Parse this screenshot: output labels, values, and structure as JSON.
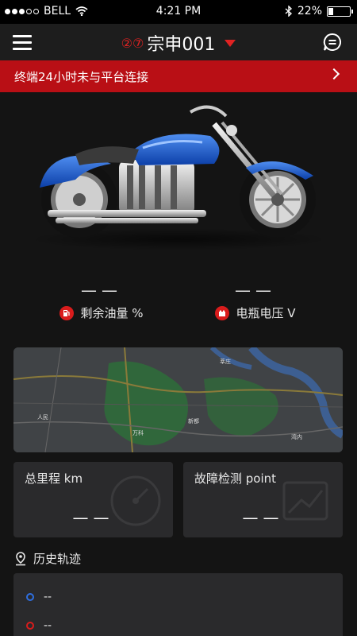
{
  "status_bar": {
    "carrier": "BELL",
    "time": "4:21 PM",
    "battery": "22%",
    "battery_level": 0.22
  },
  "nav": {
    "badge": "②⑦",
    "title": "宗申001"
  },
  "alert": {
    "text": "终端24小时未与平台连接"
  },
  "stats": [
    {
      "value": "——",
      "label": "剩余油量 %",
      "icon": "fuel-icon"
    },
    {
      "value": "——",
      "label": "电瓶电压 V",
      "icon": "battery-icon"
    }
  ],
  "map": {
    "labels": [
      "人民",
      "莘庄",
      "新都",
      "万科",
      "湾内"
    ]
  },
  "cards": [
    {
      "title": "总里程 km",
      "value": "——",
      "icon": "speedometer-icon"
    },
    {
      "title": "故障检测 point",
      "value": "——",
      "icon": "diagnostics-icon"
    }
  ],
  "history": {
    "title": "历史轨迹",
    "items": [
      {
        "text": "--",
        "color": "#2f6fe0"
      },
      {
        "text": "--",
        "color": "#d91c1c"
      }
    ]
  },
  "colors": {
    "accent": "#e02222",
    "alert_bg": "#b90f15",
    "card_bg": "#2a2a2c",
    "page_bg": "#141414"
  }
}
